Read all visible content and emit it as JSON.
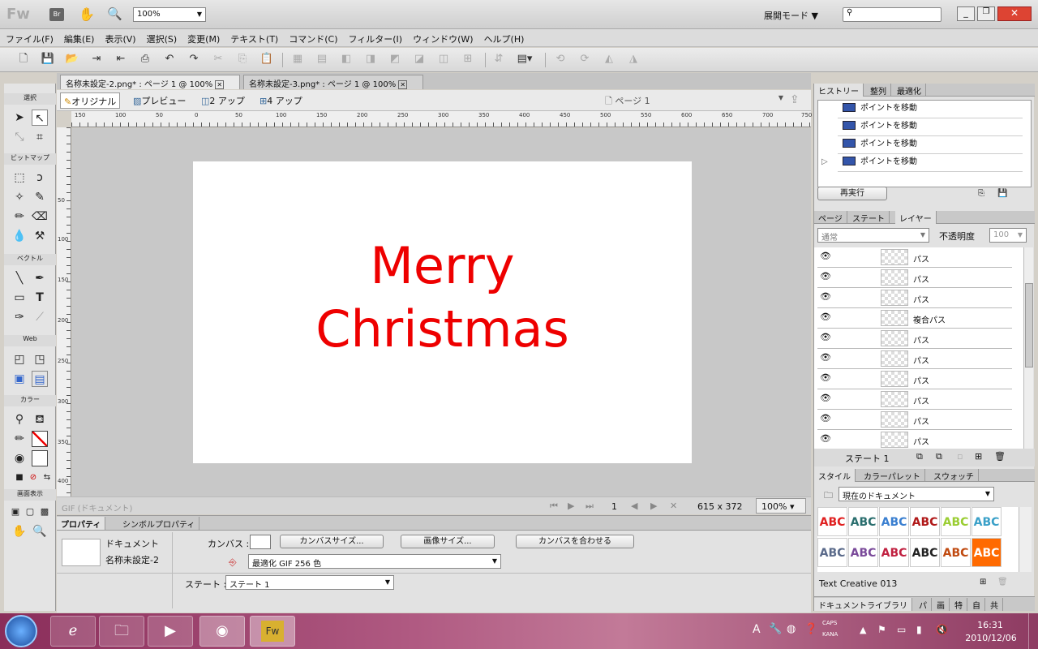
{
  "app": {
    "logo": "Fw",
    "bridge": "Br",
    "zoom": "100%",
    "workspace": "展開モード"
  },
  "menu": [
    "ファイル(F)",
    "編集(E)",
    "表示(V)",
    "選択(S)",
    "変更(M)",
    "テキスト(T)",
    "コマンド(C)",
    "フィルター(I)",
    "ウィンドウ(W)",
    "ヘルプ(H)"
  ],
  "tools": {
    "sections": {
      "select": "選択",
      "bitmap": "ビットマップ",
      "vector": "ベクトル",
      "web": "Web",
      "color": "カラー",
      "view": "画面表示"
    }
  },
  "doc_tabs": [
    {
      "label": "名称未設定-2.png* : ページ 1 @ 100%"
    },
    {
      "label": "名称未設定-3.png* : ページ 1 @ 100%"
    }
  ],
  "view_modes": {
    "original": "オリジナル",
    "preview": "プレビュー",
    "two_up": "2 アップ",
    "four_up": "4 アップ",
    "page": "ページ 1"
  },
  "ruler_h": [
    "150",
    "100",
    "50",
    "0",
    "50",
    "100",
    "150",
    "200",
    "250",
    "300",
    "350",
    "400",
    "450",
    "500",
    "550",
    "600",
    "650",
    "700",
    "750"
  ],
  "ruler_v": [
    "50",
    "100",
    "150",
    "200",
    "250",
    "300",
    "350",
    "400"
  ],
  "canvas_text": {
    "line1": "Merry",
    "line2": "Christmas"
  },
  "status": {
    "type": "GIF (ドキュメント)",
    "frame": "1",
    "size": "615 x 372",
    "zoom": "100%"
  },
  "properties": {
    "tab1": "プロパティ",
    "tab2": "シンボルプロパティ",
    "doc_label": "ドキュメント",
    "doc_name": "名称未設定-2",
    "canvas_label": "カンバス :",
    "canvas_size_btn": "カンバスサイズ...",
    "image_size_btn": "画像サイズ...",
    "fit_canvas_btn": "カンバスを合わせる",
    "export_format": "最適化 GIF 256 色",
    "state_label": "ステート :",
    "state_value": "ステート 1"
  },
  "history": {
    "tabs": [
      "ヒストリー",
      "整列",
      "最適化"
    ],
    "items": [
      "ポイントを移動",
      "ポイントを移動",
      "ポイントを移動",
      "ポイントを移動"
    ],
    "replay": "再実行"
  },
  "layers": {
    "tabs": [
      "ページ",
      "ステート",
      "レイヤー"
    ],
    "blend": "通常",
    "opacity_label": "不透明度",
    "opacity": "100",
    "items": [
      "パス",
      "パス",
      "パス",
      "複合パス",
      "パス",
      "パス",
      "パス",
      "パス",
      "パス",
      "パス"
    ],
    "state": "ステート 1"
  },
  "styles": {
    "tabs": [
      "スタイル",
      "カラーパレット",
      "スウォッチ"
    ],
    "source": "現在のドキュメント",
    "swatch_text": "ABC",
    "name": "Text Creative 013",
    "swatch_colors": [
      "#e02020",
      "#2a6e6e",
      "#3a7fd0",
      "#b01818",
      "#9acd32",
      "#3aa0c8",
      "#5a6a8a",
      "#7a4a9a",
      "#c02040",
      "#222222",
      "#c04a10",
      "#ff6a00"
    ]
  },
  "doclib": {
    "tabs": [
      "ドキュメントライブラリ",
      "パ",
      "画",
      "特",
      "自",
      "共"
    ]
  },
  "taskbar": {
    "time": "16:31",
    "date": "2010/12/06",
    "caps": "CAPS",
    "kana": "KANA"
  }
}
